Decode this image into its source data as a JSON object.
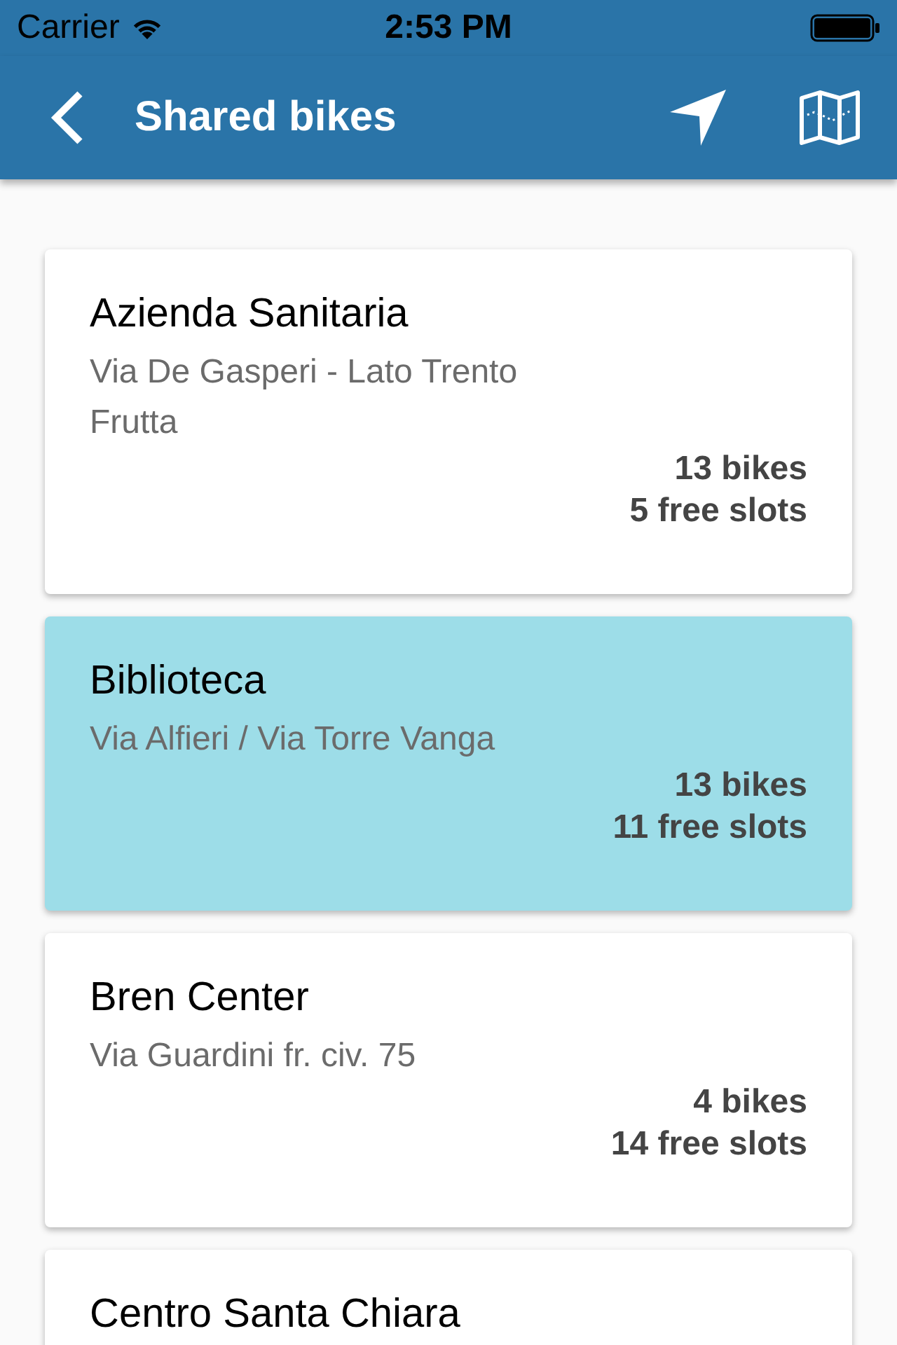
{
  "status_bar": {
    "carrier": "Carrier",
    "time": "2:53 PM"
  },
  "header": {
    "title": "Shared bikes"
  },
  "stations": [
    {
      "name": "Azienda Sanitaria",
      "address": "Via De Gasperi - Lato Trento Frutta",
      "bikes": "13 bikes",
      "free_slots": "5 free slots",
      "selected": false
    },
    {
      "name": "Biblioteca",
      "address": "Via Alfieri / Via Torre Vanga",
      "bikes": "13 bikes",
      "free_slots": "11 free slots",
      "selected": true
    },
    {
      "name": "Bren Center",
      "address": "Via Guardini fr. civ. 75",
      "bikes": "4 bikes",
      "free_slots": "14 free slots",
      "selected": false
    },
    {
      "name": "Centro Santa Chiara",
      "selected": false
    }
  ]
}
